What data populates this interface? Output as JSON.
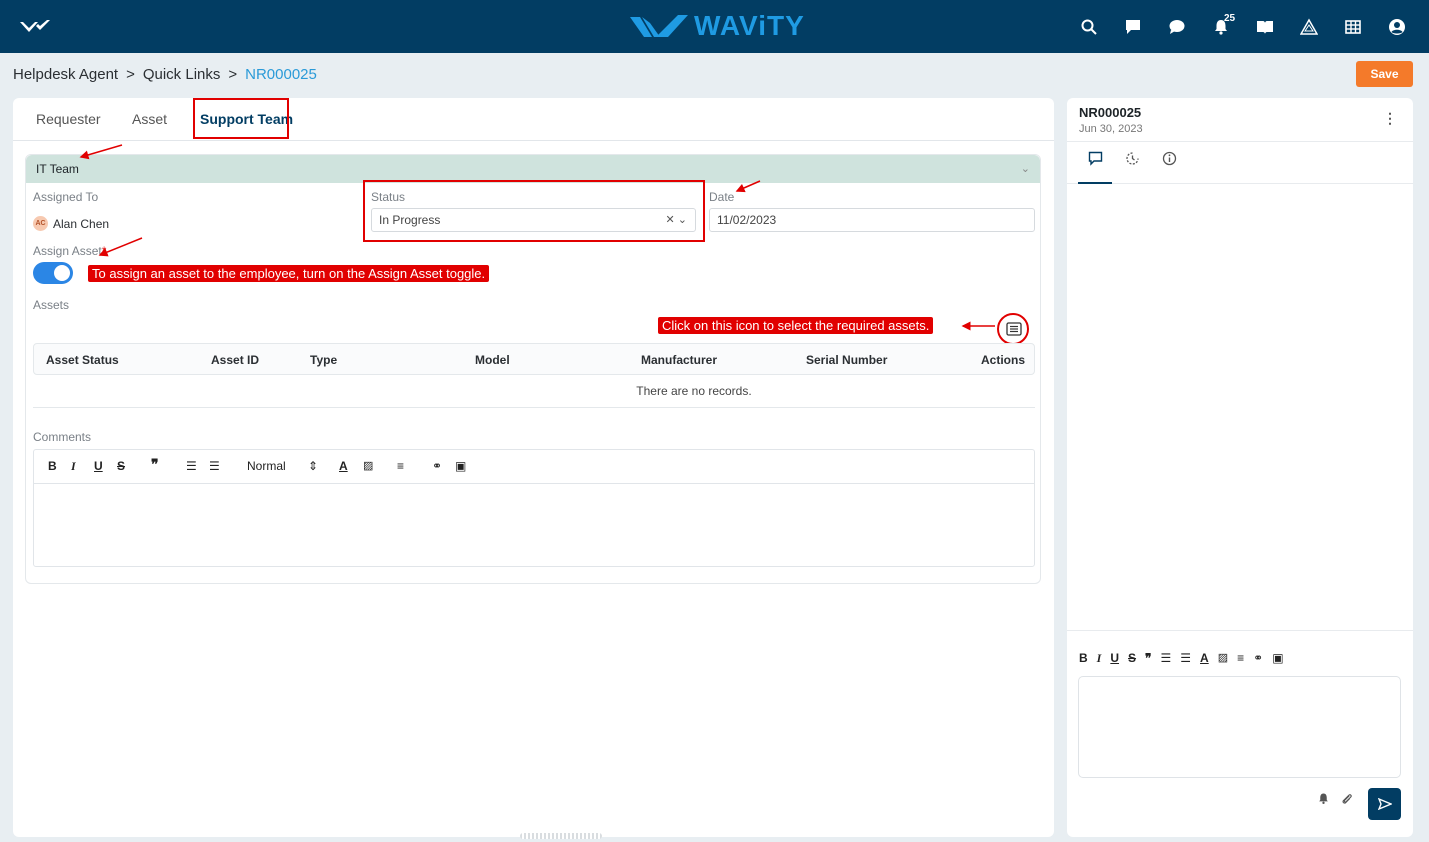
{
  "brand": {
    "name": "WAViTY"
  },
  "topbar": {
    "notifications_count": "25"
  },
  "breadcrumb": {
    "items": [
      "Helpdesk Agent",
      "Quick Links"
    ],
    "separator": ">",
    "current": "NR000025"
  },
  "toolbar": {
    "save_label": "Save"
  },
  "tabs": [
    "Requester",
    "Asset",
    "Support Team"
  ],
  "section": {
    "title": "IT Team",
    "assigned_to_label": "Assigned To",
    "assigned_user_initials": "AC",
    "assigned_user": "Alan Chen",
    "status_label": "Status",
    "status_value": "In Progress",
    "date_label": "Date",
    "date_value": "11/02/2023",
    "assign_asset_label": "Assign Asset",
    "required_mark": "*",
    "assets_label": "Assets",
    "asset_columns": [
      "Asset Status",
      "Asset ID",
      "Type",
      "Model",
      "Manufacturer",
      "Serial Number",
      "Actions"
    ],
    "no_records": "There are no records.",
    "comments_label": "Comments",
    "format_select": "Normal"
  },
  "callouts": {
    "toggle_hint": "To assign an asset to the employee, turn on the Assign Asset toggle.",
    "icon_hint": "Click on this icon to select the required assets."
  },
  "side": {
    "title": "NR000025",
    "date": "Jun 30, 2023",
    "kebab": "⋮"
  },
  "colors": {
    "topbar": "#023d63",
    "accent": "#2a9ad8",
    "save": "#f47a2a",
    "section_head": "#cfe3dd",
    "annotation": "#e10000",
    "toggle": "#2b86e5"
  }
}
